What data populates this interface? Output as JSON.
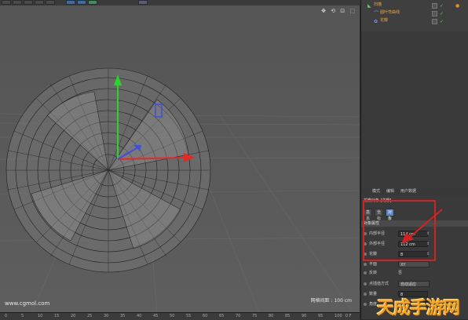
{
  "toolbar": {
    "buttons": [
      "undo-button",
      "redo-button",
      "move-button",
      "scale-button",
      "rotate-button",
      "render-button",
      "render-settings-button",
      "render-view-button",
      "camera-button"
    ]
  },
  "viewport": {
    "nav_icons": "✥ ⟲ ⊡ ⬚",
    "grid_spacing": "网格间距 : 100 cm",
    "watermark": "www.cgmol.com"
  },
  "timeline": {
    "ticks": [
      "0",
      "5",
      "10",
      "15",
      "20",
      "25",
      "30",
      "35",
      "40",
      "45",
      "50",
      "55",
      "60",
      "65",
      "70",
      "75",
      "80",
      "85",
      "90",
      "95",
      "100"
    ],
    "end_label": "0 F"
  },
  "object_manager": {
    "rows": [
      {
        "label": "扫描",
        "indent": 6
      },
      {
        "label": "圆叶弯曲线",
        "indent": 14
      },
      {
        "label": "花瓣",
        "indent": 14
      }
    ]
  },
  "attributes": {
    "menu": [
      "模式",
      "编辑",
      "用户数据"
    ],
    "object_title": "花瓣对象 [花瓣]",
    "tabs": [
      "基本",
      "坐标",
      "对象"
    ],
    "active_tab": 2,
    "section": "对象属性",
    "props": [
      {
        "label": "内部半径",
        "value": "114 cm"
      },
      {
        "label": "外部半径",
        "value": "112 cm"
      },
      {
        "label": "花瓣",
        "value": "8"
      }
    ],
    "plane": {
      "label": "平面",
      "value": "XY"
    },
    "reverse": {
      "label": "反转",
      "value": "否"
    },
    "interp": {
      "label": "点插值方式",
      "value": "自动适应"
    },
    "count": {
      "label": "数量",
      "value": "8"
    },
    "angle": {
      "label": "角度",
      "value": "5°"
    }
  },
  "logo": {
    "text": "天成手游网"
  },
  "colors": {
    "accent": "#5b87c7",
    "highlight": "#d42222",
    "x_axis": "#e02b2b",
    "y_axis": "#2bd42b",
    "z_axis": "#3b4fe0"
  }
}
